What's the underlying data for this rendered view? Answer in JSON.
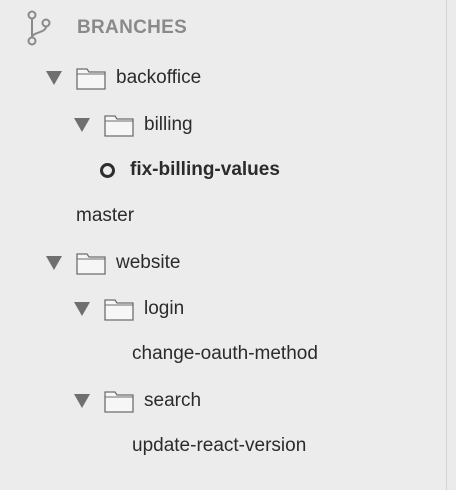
{
  "sidebar": {
    "section_title": "BRANCHES",
    "items": [
      {
        "label": "backoffice",
        "type": "folder",
        "expanded": true
      },
      {
        "label": "billing",
        "type": "folder",
        "expanded": true
      },
      {
        "label": "fix-billing-values",
        "type": "branch",
        "current": true
      },
      {
        "label": "master",
        "type": "branch"
      },
      {
        "label": "website",
        "type": "folder",
        "expanded": true
      },
      {
        "label": "login",
        "type": "folder",
        "expanded": true
      },
      {
        "label": "change-oauth-method",
        "type": "branch"
      },
      {
        "label": "search",
        "type": "folder",
        "expanded": true
      },
      {
        "label": "update-react-version",
        "type": "branch"
      }
    ]
  },
  "icons": {
    "section": "git-branch-icon",
    "folder": "folder-icon",
    "disclosure": "triangle-down-icon",
    "current_branch": "current-branch-circle-icon"
  }
}
